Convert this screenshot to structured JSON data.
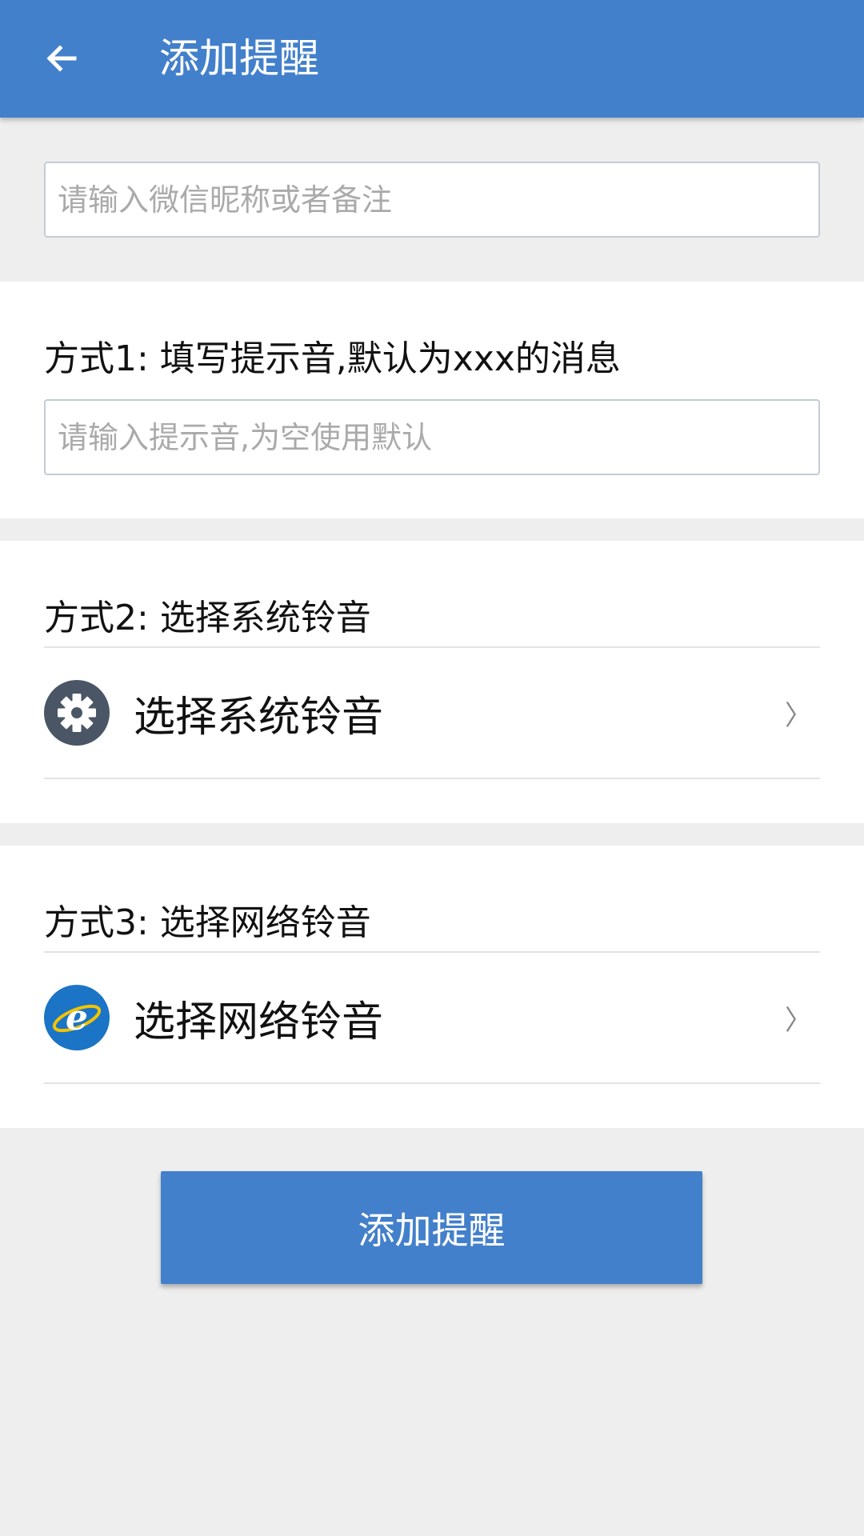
{
  "colors": {
    "accent": "#4380cb",
    "background": "#eeeeee",
    "gear_icon_bg": "#4a5666",
    "browser_icon_bg": "#1b74c5"
  },
  "app_bar": {
    "back_icon": "arrow-left-icon",
    "title": "添加提醒"
  },
  "name_field": {
    "value": "",
    "placeholder": "请输入微信昵称或者备注"
  },
  "method1": {
    "heading": "方式1: 填写提示音,默认为xxx的消息",
    "input": {
      "value": "",
      "placeholder": "请输入提示音,为空使用默认"
    }
  },
  "method2": {
    "heading": "方式2: 选择系统铃音",
    "row": {
      "icon": "gear-icon",
      "label": "选择系统铃音",
      "chevron": "〉"
    }
  },
  "method3": {
    "heading": "方式3: 选择网络铃音",
    "row": {
      "icon": "browser-icon",
      "label": "选择网络铃音",
      "chevron": "〉"
    }
  },
  "submit_label": "添加提醒"
}
